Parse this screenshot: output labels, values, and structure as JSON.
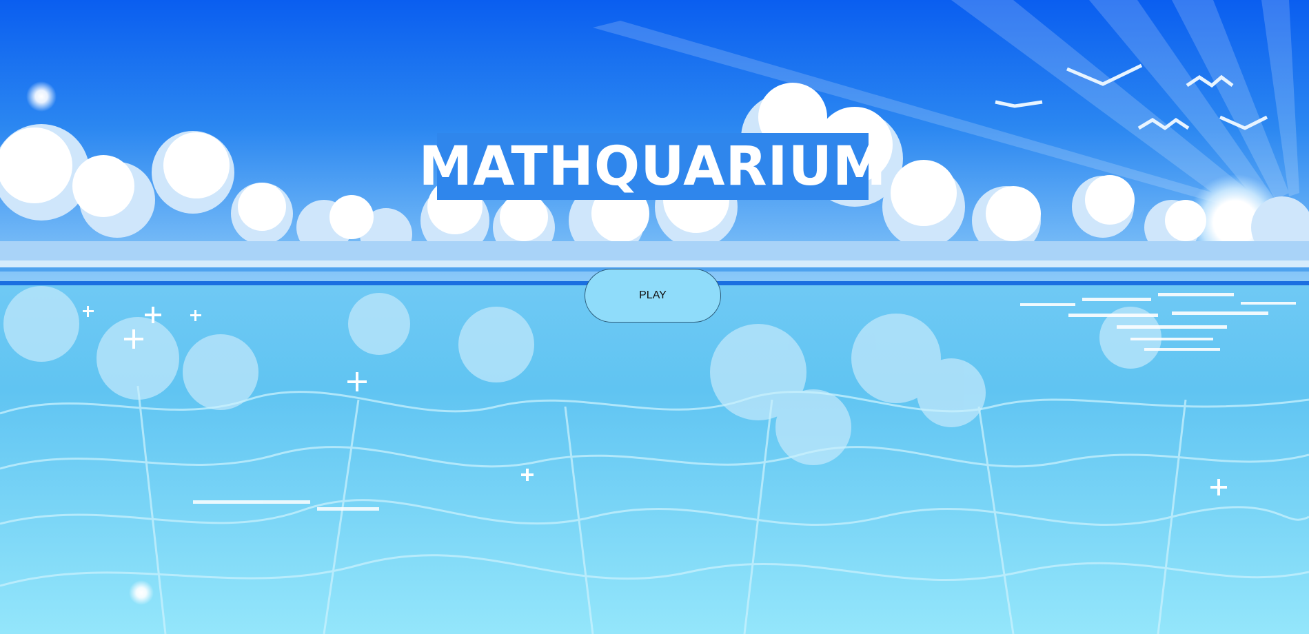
{
  "game": {
    "title": "MATHQUARIUM",
    "play_label": "PLAY"
  },
  "scene": {
    "background": "pixel-art ocean and sky",
    "colors": {
      "sky_top": "#0a5ef0",
      "sky_mid": "#2e8cf2",
      "sky_horizon": "#7ec3f7",
      "horizon_line": "#1a6fe0",
      "water_top": "#74d2f6",
      "water_bottom": "#8fe6fb",
      "title_bg": "#2f86ec",
      "button_bg": "#8fdcfa",
      "button_border": "#2a5a78"
    },
    "icons": [
      "sun-icon",
      "bird-icon",
      "cloud-icon",
      "sparkle-icon"
    ]
  }
}
